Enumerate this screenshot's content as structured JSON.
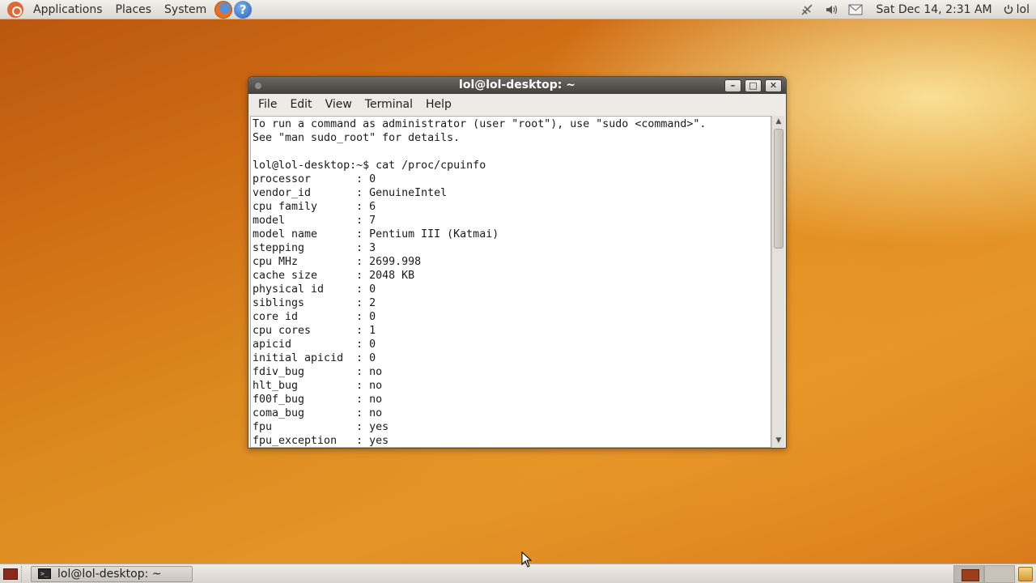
{
  "top_panel": {
    "menus": [
      "Applications",
      "Places",
      "System"
    ],
    "clock": "Sat Dec 14,  2:31 AM",
    "user": "lol",
    "icons": [
      "ubuntu-logo",
      "firefox-icon",
      "help-icon",
      "network-icon",
      "volume-icon",
      "mail-icon",
      "power-icon"
    ]
  },
  "window": {
    "title": "lol@lol-desktop: ~",
    "menu": [
      "File",
      "Edit",
      "View",
      "Terminal",
      "Help"
    ],
    "buttons": [
      "minimize",
      "maximize",
      "close"
    ],
    "lines": [
      "To run a command as administrator (user \"root\"), use \"sudo <command>\".",
      "See \"man sudo_root\" for details.",
      "",
      "lol@lol-desktop:~$ cat /proc/cpuinfo",
      "processor       : 0",
      "vendor_id       : GenuineIntel",
      "cpu family      : 6",
      "model           : 7",
      "model name      : Pentium III (Katmai)",
      "stepping        : 3",
      "cpu MHz         : 2699.998",
      "cache size      : 2048 KB",
      "physical id     : 0",
      "siblings        : 2",
      "core id         : 0",
      "cpu cores       : 1",
      "apicid          : 0",
      "initial apicid  : 0",
      "fdiv_bug        : no",
      "hlt_bug         : no",
      "f00f_bug        : no",
      "coma_bug        : no",
      "fpu             : yes",
      "fpu_exception   : yes"
    ]
  },
  "bottom_panel": {
    "task_label": "lol@lol-desktop: ~"
  }
}
